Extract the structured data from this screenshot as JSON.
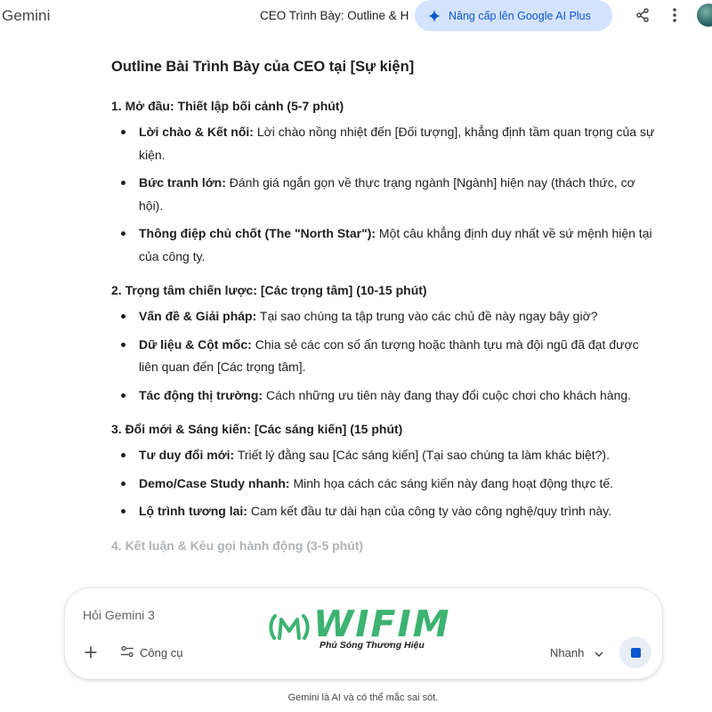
{
  "header": {
    "brand": "Gemini",
    "conversation_title": "CEO Trình Bày: Outline & H",
    "upgrade_label": "Nâng cấp lên Google AI Plus",
    "share_icon": "share-icon",
    "more_icon": "more-vert-icon"
  },
  "document": {
    "title": "Outline Bài Trình Bày của CEO tại [Sự kiện]",
    "sections": [
      {
        "heading": "1. Mở đầu: Thiết lập bối cảnh (5-7 phút)",
        "bullets": [
          {
            "term": "Lời chào & Kết nối:",
            "text": " Lời chào nồng nhiệt đến [Đối tượng], khẳng định tầm quan trọng của sự kiện."
          },
          {
            "term": "Bức tranh lớn:",
            "text": " Đánh giá ngắn gọn về thực trạng ngành [Ngành] hiện nay (thách thức, cơ hội)."
          },
          {
            "term": "Thông điệp chủ chốt (The \"North Star\"):",
            "text": " Một câu khẳng định duy nhất về sứ mệnh hiện tại của công ty."
          }
        ]
      },
      {
        "heading": "2. Trọng tâm chiến lược: [Các trọng tâm] (10-15 phút)",
        "bullets": [
          {
            "term": "Vấn đề & Giải pháp:",
            "text": " Tại sao chúng ta tập trung vào các chủ đề này ngay bây giờ?"
          },
          {
            "term": "Dữ liệu & Cột mốc:",
            "text": " Chia sẻ các con số ấn tượng hoặc thành tựu mà đội ngũ đã đạt được liên quan đến [Các trọng tâm]."
          },
          {
            "term": "Tác động thị trường:",
            "text": " Cách những ưu tiên này đang thay đổi cuộc chơi cho khách hàng."
          }
        ]
      },
      {
        "heading": "3. Đổi mới & Sáng kiến: [Các sáng kiến] (15 phút)",
        "bullets": [
          {
            "term": "Tư duy đổi mới:",
            "text": " Triết lý đằng sau [Các sáng kiến] (Tại sao chúng ta làm khác biệt?)."
          },
          {
            "term": "Demo/Case Study nhanh:",
            "text": " Minh họa cách các sáng kiến này đang hoạt động thực tế."
          },
          {
            "term": "Lộ trình tương lai:",
            "text": " Cam kết đầu tư dài hạn của công ty vào công nghệ/quy trình này."
          }
        ]
      },
      {
        "heading": "4. Kết luận & Kêu gọi hành động (3-5 phút)",
        "bullets": []
      }
    ]
  },
  "composer": {
    "placeholder": "Hỏi Gemini 3",
    "tools_label": "Công cụ",
    "model_label": "Nhanh",
    "add_icon": "plus-icon",
    "tools_icon": "tools-sliders-icon",
    "model_icon": "chevron-down-icon",
    "stop_icon": "stop-icon"
  },
  "watermark": {
    "name": "WIFIM",
    "tagline": "Phủ Sóng Thương Hiệu",
    "color": "#3cb371"
  },
  "footer": {
    "disclaimer": "Gemini là AI và có thể mắc sai sót."
  },
  "colors": {
    "accent": "#0b57d0",
    "pill_bg": "#d3e3fd",
    "text": "#1f1f1f",
    "muted": "#444746"
  }
}
